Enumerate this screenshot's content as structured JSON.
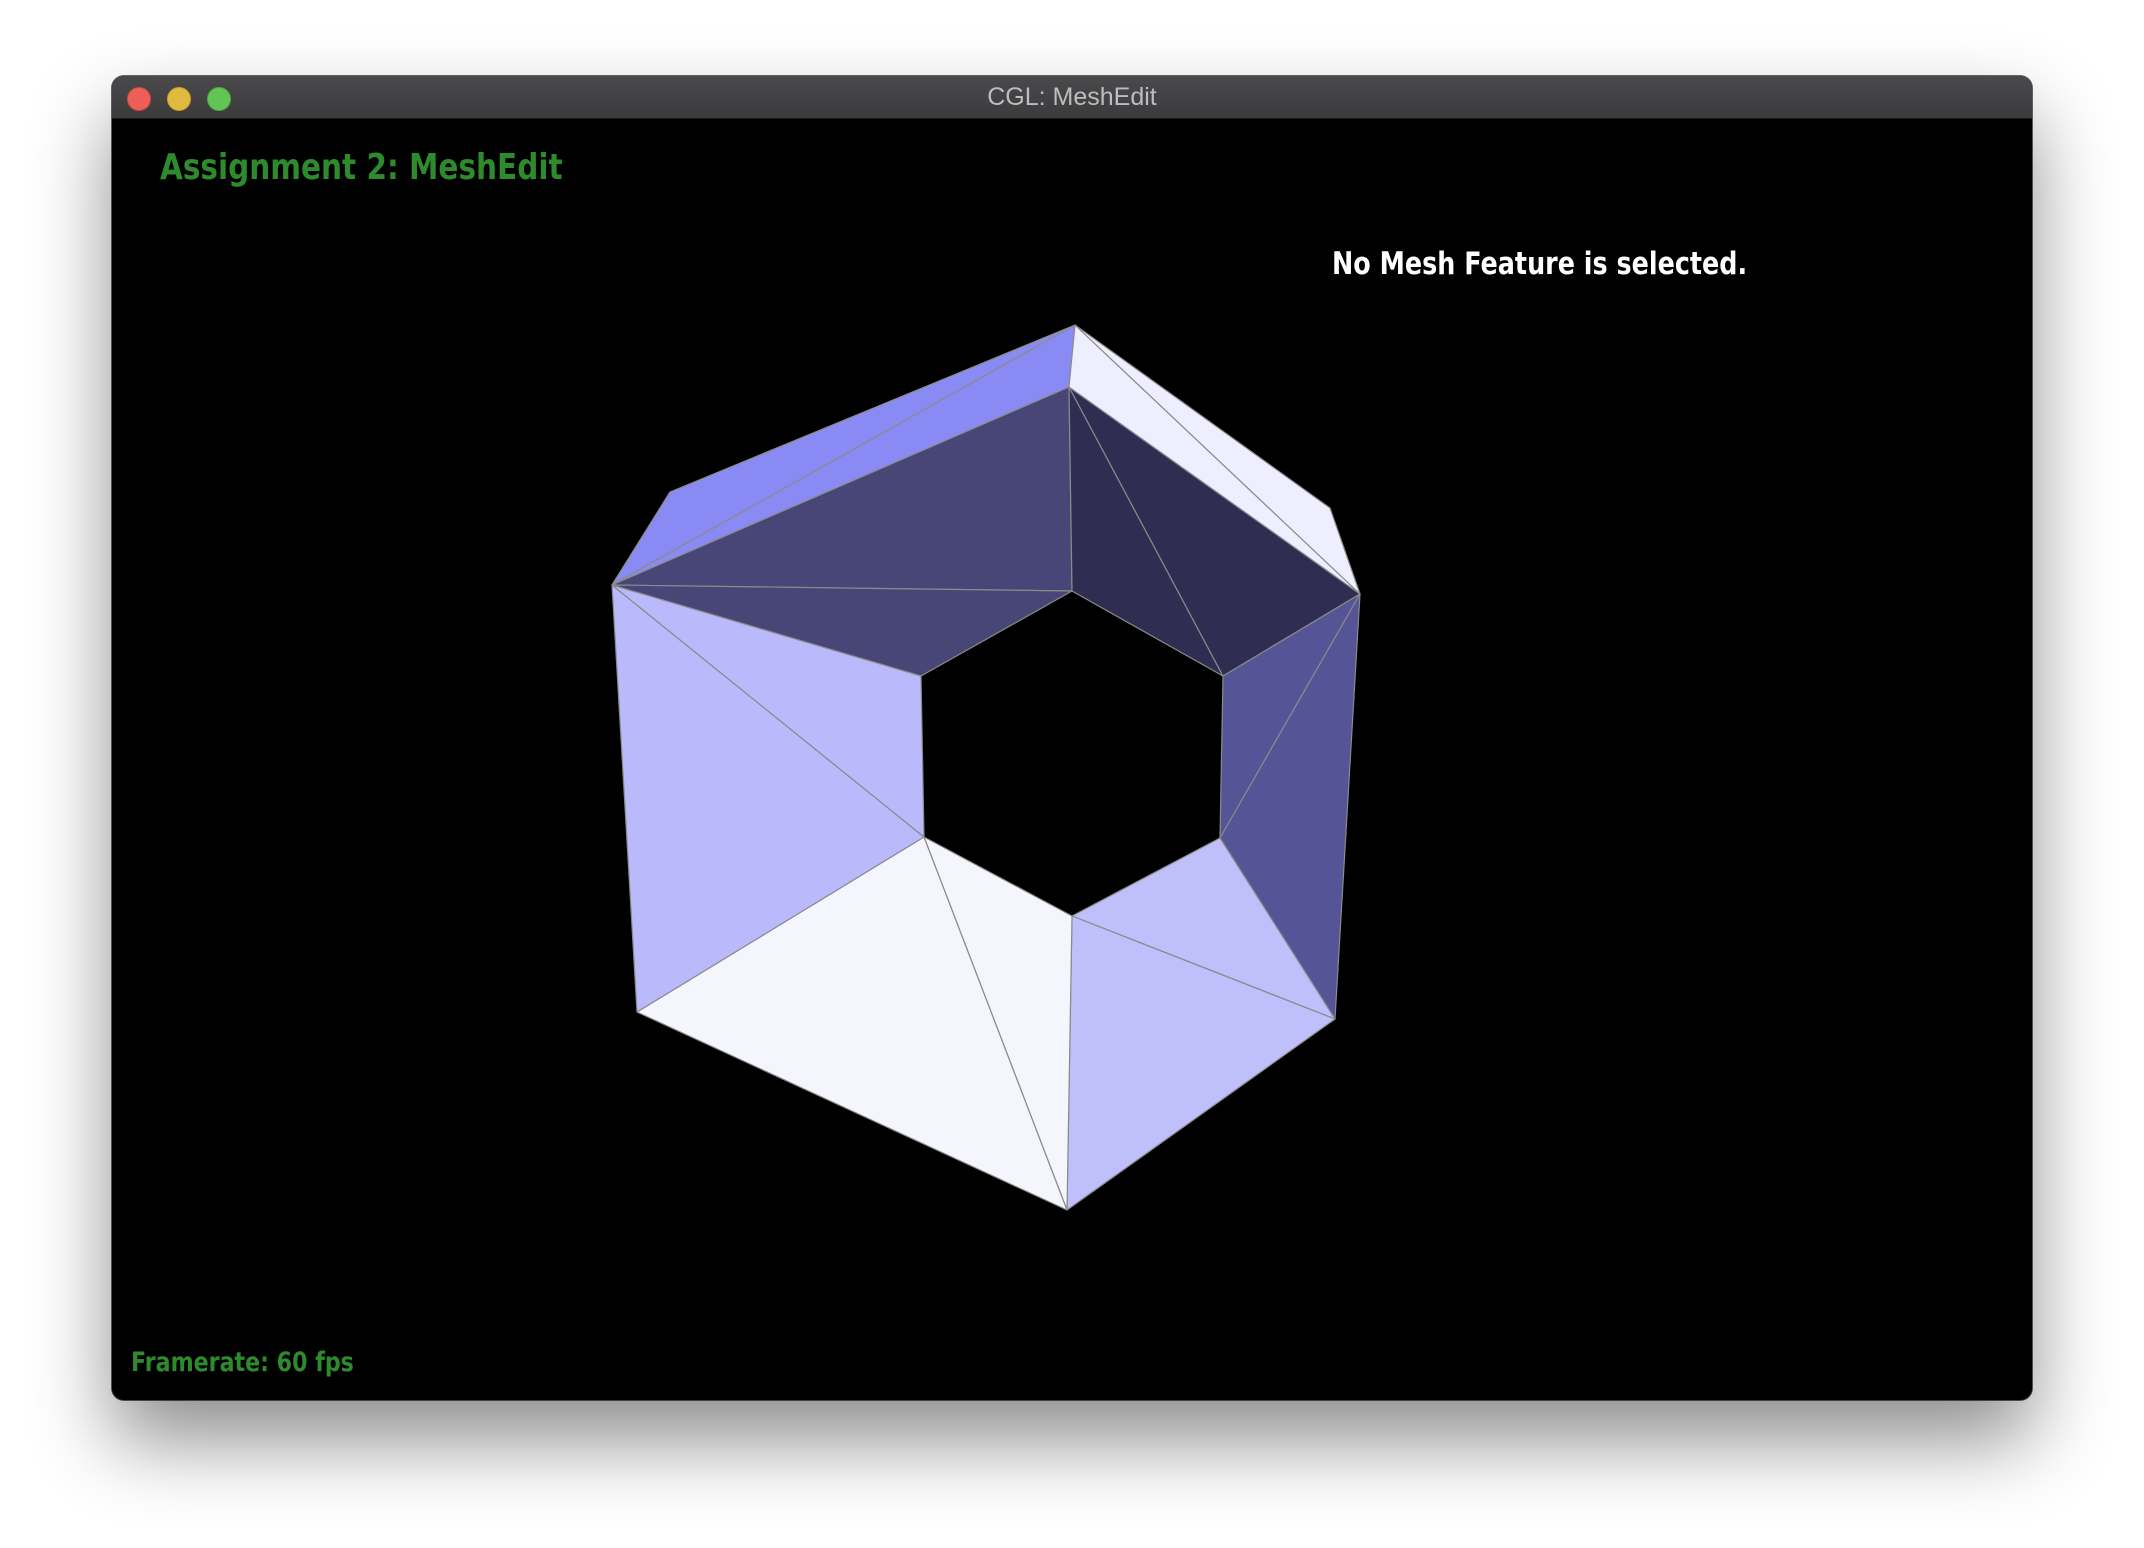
{
  "window": {
    "title": "CGL: MeshEdit",
    "controls": [
      "close-button",
      "minimize-button",
      "maximize-button"
    ]
  },
  "hud": {
    "title": "Assignment 2: MeshEdit",
    "selection_status": "No Mesh Feature is selected.",
    "framerate": "Framerate: 60 fps"
  },
  "colors": {
    "hud_green": "#2d8a2d",
    "background": "#000000",
    "edge": "#8a8a8a"
  },
  "mesh": {
    "shape": "hexagonal ring",
    "face_colors": [
      "#8a8af5",
      "#8a8af5",
      "#474676",
      "#474676",
      "#2f2e52",
      "#2f2e52",
      "#eeeefe",
      "#eeeefe",
      "#555496",
      "#555496",
      "#bfbffb",
      "#bfbffb",
      "#f5f6fd",
      "#f5f6fd",
      "#b9b9fb",
      "#b9b9fb"
    ]
  }
}
